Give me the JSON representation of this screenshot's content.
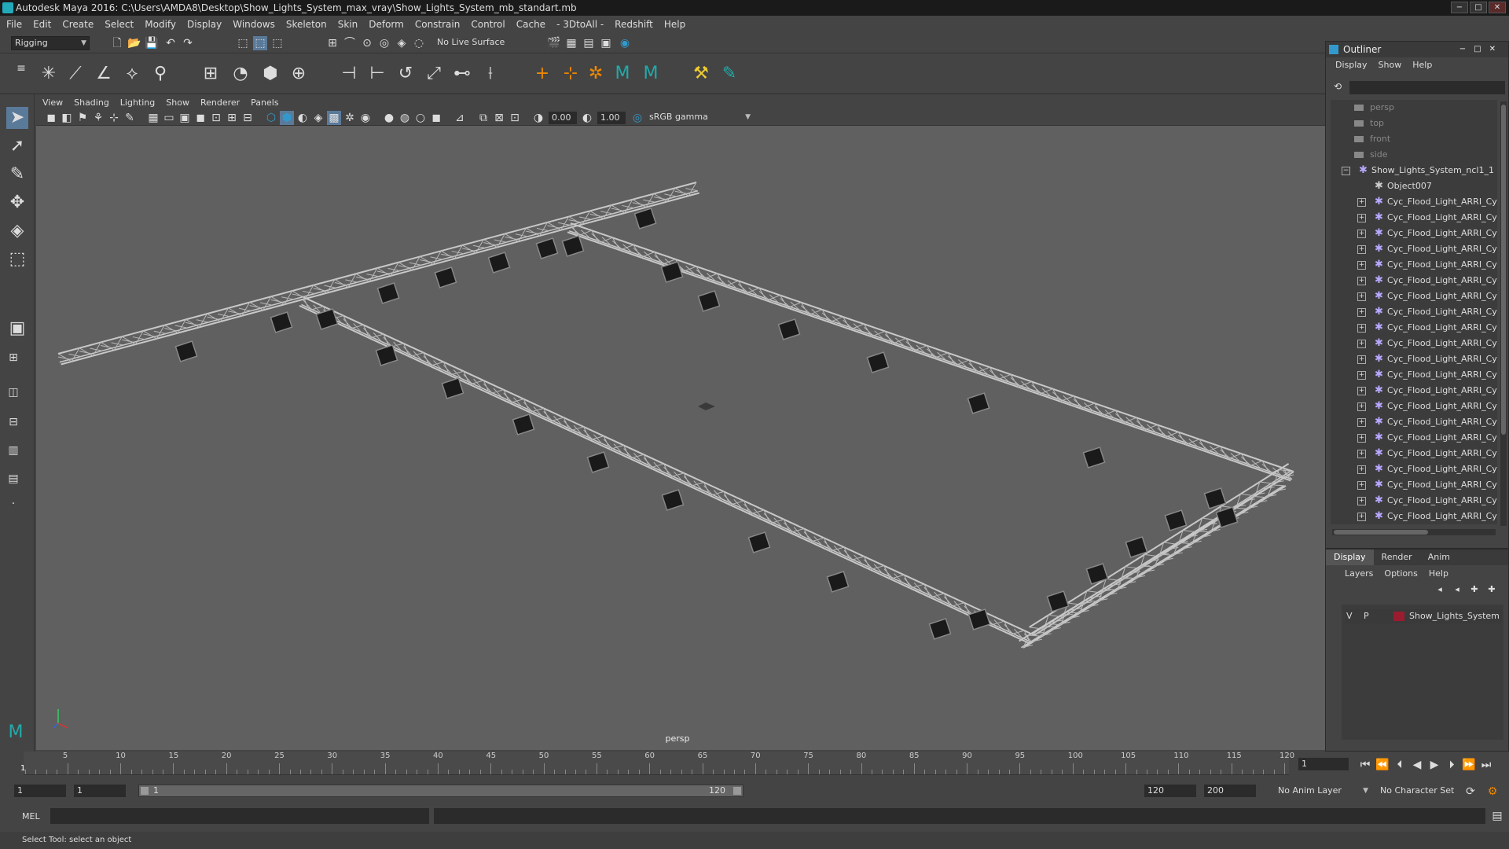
{
  "window": {
    "title": "Autodesk Maya 2016: C:\\Users\\AMDA8\\Desktop\\Show_Lights_System_max_vray\\Show_Lights_System_mb_standart.mb",
    "buttons": [
      "−",
      "□",
      "✕"
    ]
  },
  "menubar": [
    "File",
    "Edit",
    "Create",
    "Select",
    "Modify",
    "Display",
    "Windows",
    "Skeleton",
    "Skin",
    "Deform",
    "Constrain",
    "Control",
    "Cache",
    "- 3DtoAll -",
    "Redshift",
    "Help"
  ],
  "status_line": {
    "mode": "Rigging",
    "live_surface": "No Live Surface"
  },
  "viewport": {
    "menu": [
      "View",
      "Shading",
      "Lighting",
      "Show",
      "Renderer",
      "Panels"
    ],
    "exposure": "0.00",
    "gamma": "1.00",
    "color_space": "sRGB gamma",
    "camera_label": "persp"
  },
  "outliner": {
    "title": "Outliner",
    "menu": [
      "Display",
      "Show",
      "Help"
    ],
    "cameras": [
      "persp",
      "top",
      "front",
      "side"
    ],
    "root": "Show_Lights_System_ncl1_1",
    "child_object": "Object007",
    "light_item": "Cyc_Flood_Light_ARRI_Cy",
    "light_count": 21
  },
  "layer_editor": {
    "tabs": [
      "Display",
      "Render",
      "Anim"
    ],
    "active_tab": "Display",
    "menu": [
      "Layers",
      "Options",
      "Help"
    ],
    "layer": {
      "v": "V",
      "p": "P",
      "name": "Show_Lights_System",
      "color": "#9b1c2e"
    }
  },
  "timeline": {
    "ticks": [
      5,
      10,
      15,
      20,
      25,
      30,
      35,
      40,
      45,
      50,
      55,
      60,
      65,
      70,
      75,
      80,
      85,
      90,
      95,
      100,
      105,
      110,
      115,
      120
    ],
    "start_label": "1",
    "current_frame": "1"
  },
  "range": {
    "start": "1",
    "playback_start": "1",
    "slider_start": "1",
    "slider_end": "120",
    "playback_end": "120",
    "end": "200",
    "anim_layer": "No Anim Layer",
    "character_set": "No Character Set"
  },
  "command_line": {
    "label": "MEL"
  },
  "help_line": "Select Tool: select an object",
  "colors": {
    "viewport_bg": "#606060",
    "truss": "#c8c8c8",
    "light": "#1a1a1a",
    "accent": "#3399cc"
  }
}
